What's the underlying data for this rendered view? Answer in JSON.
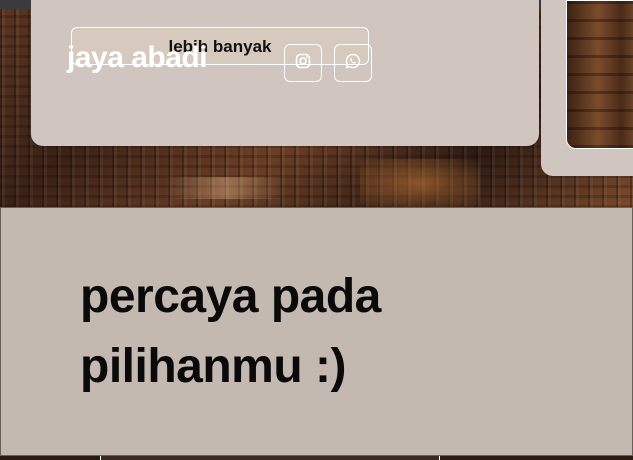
{
  "header": {
    "brand": "jaya abadi",
    "more_button_label": "lebih banyak"
  },
  "social": [
    {
      "name": "instagram",
      "icon": "instagram-icon"
    },
    {
      "name": "whatsapp",
      "icon": "whatsapp-icon"
    }
  ],
  "hero": {
    "headline_line1": "percaya pada",
    "headline_line2": "pilihanmu :)"
  },
  "colors": {
    "card": "#d0c6bf",
    "band": "#c4b9b0",
    "text": "#0a0a0a",
    "topbar": "#3b3b3b"
  }
}
